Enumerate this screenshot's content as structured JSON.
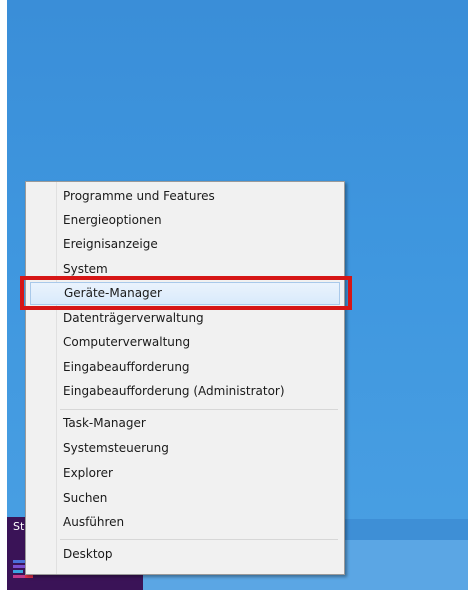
{
  "desktop": {
    "start_label": "St"
  },
  "context_menu": {
    "items_group1": [
      "Programme und Features",
      "Energieoptionen",
      "Ereignisanzeige",
      "System",
      "Geräte-Manager",
      "Datenträgerverwaltung",
      "Computerverwaltung",
      "Eingabeaufforderung",
      "Eingabeaufforderung (Administrator)"
    ],
    "items_group2": [
      "Task-Manager",
      "Systemsteuerung",
      "Explorer",
      "Suchen",
      "Ausführen"
    ],
    "items_group3": [
      "Desktop"
    ],
    "highlighted_item": "Geräte-Manager"
  },
  "colors": {
    "highlight_border": "#d61616",
    "desktop_blue": "#3f97df",
    "start_tile": "#3a1357"
  }
}
